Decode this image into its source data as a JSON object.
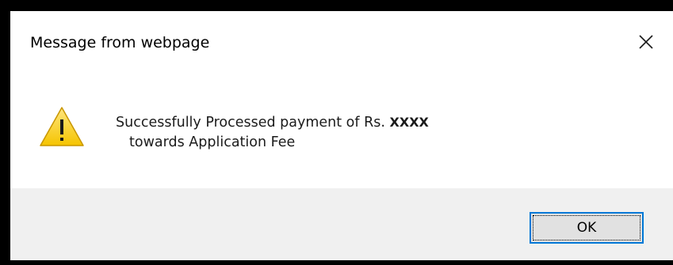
{
  "dialog": {
    "title": "Message from webpage",
    "icon": "warning-triangle-icon",
    "close_icon": "close-icon",
    "message_line1_prefix": "Successfully Processed payment of Rs.",
    "message_amount": "XXXX",
    "message_line2": "towards Application Fee",
    "ok_label": "OK"
  },
  "colors": {
    "warning_yellow": "#fcd116",
    "button_border": "#0078d7",
    "footer_bg": "#f0f0f0"
  }
}
